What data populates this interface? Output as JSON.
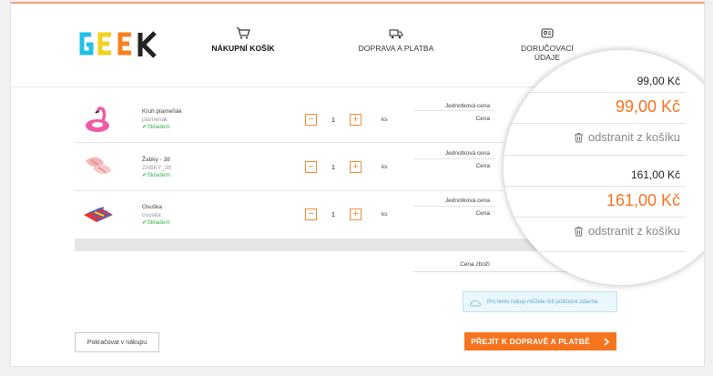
{
  "logo": {
    "text": "GEEK"
  },
  "steps": [
    {
      "label": "NÁKUPNÍ KOŠÍK",
      "icon": "cart-icon",
      "active": true
    },
    {
      "label": "DOPRAVA A PLATBA",
      "icon": "truck-icon",
      "active": false
    },
    {
      "label": "DORUČOVACÍ ÚDAJE",
      "icon": "address-card-icon",
      "active": false
    }
  ],
  "items": [
    {
      "name": "Kruh plameňák",
      "code": "plamenak",
      "stock": "✔Skladem",
      "qty": "1",
      "unit": "ks",
      "unit_price_label": "Jednotková cena",
      "price_label": "Cena",
      "unit_price": "99,00 Kč",
      "price": "99,00 Kč",
      "remove": "odstranit z košíku"
    },
    {
      "name": "Žabky - 38",
      "code": "ZABKY_38",
      "stock": "✔Skladem",
      "qty": "1",
      "unit": "ks",
      "unit_price_label": "Jednotková cena",
      "price_label": "Cena",
      "unit_price": "161,00 Kč",
      "price": "161,00 Kč",
      "remove": "odstranit z košíku"
    },
    {
      "name": "Osuška",
      "code": "osuska",
      "stock": "✔Skladem",
      "qty": "1",
      "unit": "ks",
      "unit_price_label": "Jednotková cena",
      "price_label": "Cena"
    }
  ],
  "summary": {
    "goods_price_label": "Cena zboží"
  },
  "note": "Pro tento nákup můžete mít poštovné zdarma",
  "buttons": {
    "continue": "Pokračovat v nákupu",
    "next": "PŘEJÍT K DOPRAVĚ A PLATBĚ"
  },
  "colors": {
    "accent": "#f7741f",
    "stock": "#3fb34f"
  }
}
